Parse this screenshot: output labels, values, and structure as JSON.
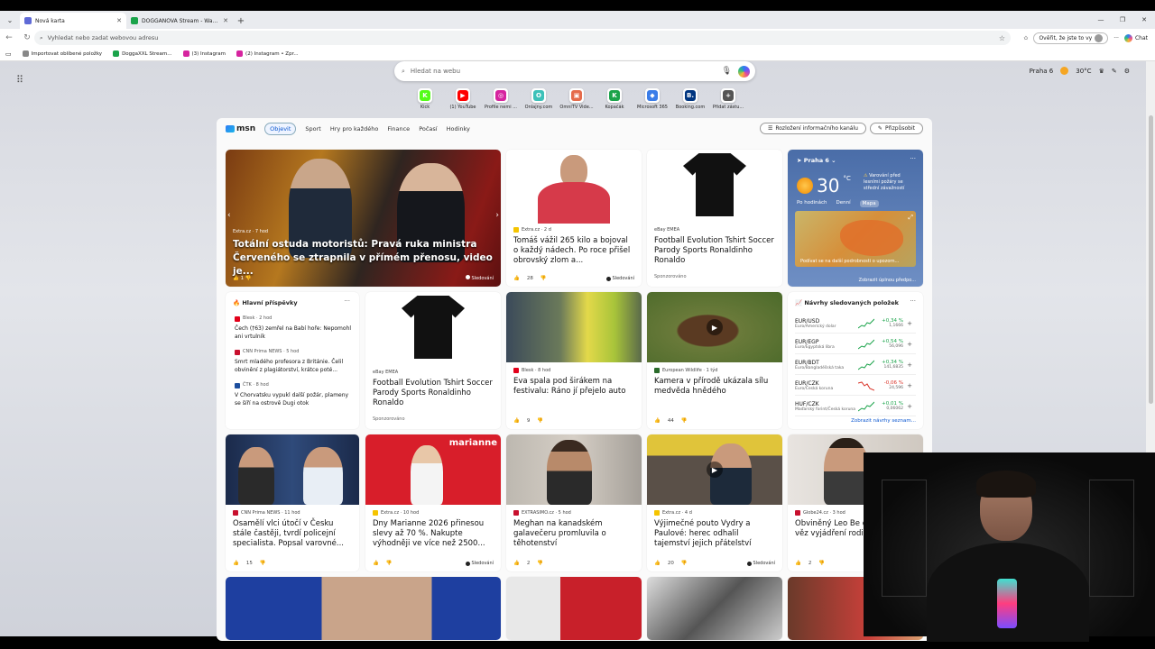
{
  "tabs": [
    {
      "label": "Nová karta",
      "color": "#5f6ad6",
      "active": true
    },
    {
      "label": "DOGGANOVA Stream - Watch Live",
      "color": "#1aa34a",
      "active": false
    }
  ],
  "address": {
    "placeholder": "Vyhledat nebo zadat webovou adresu"
  },
  "nav_right": {
    "verify": "Ověřit, že jste to vy",
    "chat": "Chat"
  },
  "bookmarks": [
    {
      "label": "Importovat oblíbené položky",
      "color": "#666"
    },
    {
      "label": "DoggaXXL Stream...",
      "color": "#1aa34a"
    },
    {
      "label": "(3) Instagram",
      "color": "#d6249f"
    },
    {
      "label": "(2) Instagram • Zpr...",
      "color": "#d6249f"
    }
  ],
  "search": {
    "placeholder": "Hledat na webu"
  },
  "weather_top": {
    "location": "Praha 6",
    "temp": "30",
    "unit": "°C"
  },
  "quick_links": [
    {
      "label": "Kick",
      "letter": "K",
      "color": "#53fc18"
    },
    {
      "label": "(1) YouTube",
      "letter": "▶",
      "color": "#ff0000"
    },
    {
      "label": "Profile nemi ...",
      "letter": "◎",
      "color": "#d6249f"
    },
    {
      "label": "Onlajny.com",
      "letter": "O",
      "color": "#3dc1b9"
    },
    {
      "label": "OmniTV Vide...",
      "letter": "▣",
      "color": "#e56b4b"
    },
    {
      "label": "Kopačák",
      "letter": "K",
      "color": "#1aa34a"
    },
    {
      "label": "Microsoft 365",
      "letter": "◆",
      "color": "#3b7de8"
    },
    {
      "label": "Booking.com",
      "letter": "B.",
      "color": "#003580"
    },
    {
      "label": "Přidat zástu...",
      "letter": "+",
      "color": "#555"
    }
  ],
  "msn": {
    "logo": "msn",
    "tabs": [
      "Objevit",
      "Sport",
      "Hry pro každého",
      "Finance",
      "Počasí",
      "Hodinky"
    ],
    "feed_layout_btn": "Rozložení informačního kanálu",
    "customize_btn": "Přizpůsobit"
  },
  "hero": {
    "source": "Extra.cz · 7 hod",
    "title": "Totální ostuda motoristů: Pravá ruka ministra Červeného se ztrapnila v přímém přenosu, video je...",
    "likes": "1",
    "follow": "Sledování"
  },
  "cards": [
    {
      "source": "Extra.cz · 2 d",
      "src_color": "#f5c400",
      "title": "Tomáš vážil 265 kilo a bojoval o každý nádech. Po roce přišel obrovský zlom a...",
      "likes": "28",
      "follow": "Sledování"
    },
    {
      "source": "eBay EMEA",
      "title": "Football Evolution Tshirt Soccer Parody Sports Ronaldinho Ronaldo",
      "sponsored": "Sponzorováno"
    },
    {
      "source": "eBay EMEA",
      "title": "Football Evolution Tshirt Soccer Parody Sports Ronaldinho Ronaldo",
      "sponsored": "Sponzorováno"
    },
    {
      "source": "Blesk · 8 hod",
      "src_color": "#e2001a",
      "title": "Eva spala pod širákem na festivalu: Ráno jí přejelo auto",
      "likes": "9"
    },
    {
      "source": "European Wildlife · 1 týd",
      "src_color": "#2a6b2a",
      "title": "Kamera v přírodě ukázala sílu medvěda hnědého",
      "likes": "44"
    },
    {
      "source": "CNN Prima NEWS · 11 hod",
      "src_color": "#c8102e",
      "title": "Osamělí vlci útočí v Česku stále častěji, tvrdí policejní specialista. Popsal varovné...",
      "likes": "15"
    },
    {
      "source": "Extra.cz · 10 hod",
      "src_color": "#f5c400",
      "title": "Dny Marianne 2026 přinesou slevy až 70 %. Nakupte výhodněji ve více než 2500...",
      "follow": "Sledování"
    },
    {
      "source": "EXTRASIMO.cz · 5 hod",
      "src_color": "#c8102e",
      "title": "Meghan na kanadském galavečeru promluvila o těhotenství",
      "likes": "2"
    },
    {
      "source": "Extra.cz · 4 d",
      "src_color": "#f5c400",
      "title": "Výjimečné pouto Vydry a Paulové: herec odhalil tajemství jejich přátelství",
      "likes": "20",
      "follow": "Sledování"
    },
    {
      "source": "Globe24.cz · 3 hod",
      "src_color": "#c8102e",
      "title": "Obviněný Leo Be dostat 12 let věz vyjádření rodiny",
      "likes": "2"
    }
  ],
  "weather_card": {
    "location": "Praha 6",
    "temp": "30",
    "unit": "°C",
    "alert": "Varování před lesními požáry se střední závažností",
    "tabs": [
      "Po hodinách",
      "Denní",
      "Mapa"
    ],
    "footer": "Podívat se na další podrobnosti o upozorn...",
    "link": "Zobrazit úplnou předpo..."
  },
  "main_posts": {
    "heading": "Hlavní příspěvky",
    "items": [
      {
        "source": "Blesk · 2 hod",
        "color": "#e2001a",
        "text": "Čech (†63) zemřel na Babí hoře: Nepomohl ani vrtulník"
      },
      {
        "source": "CNN Prima NEWS · 5 hod",
        "color": "#c8102e",
        "text": "Smrt mladého profesora z Británie. Čelil obvinění z plagiátorství, krátce poté..."
      },
      {
        "source": "ČTK · 8 hod",
        "color": "#1d4e9e",
        "text": "V Chorvatsku vypukl další požár, plameny se šíří na ostrově Dugi otok"
      }
    ]
  },
  "watchlist": {
    "heading": "Návrhy sledovaných položek",
    "link": "Zobrazit návrhy seznam...",
    "rows": [
      {
        "pair": "EUR/USD",
        "desc": "Euro/Americký dolar",
        "change": "+0,34 %",
        "value": "1,1666",
        "up": true
      },
      {
        "pair": "EUR/EGP",
        "desc": "Euro/Egyptská libra",
        "change": "+0,54 %",
        "value": "56,096",
        "up": true
      },
      {
        "pair": "EUR/BDT",
        "desc": "Euro/Bangladéšská taka",
        "change": "+0,34 %",
        "value": "141,6835",
        "up": true
      },
      {
        "pair": "EUR/CZK",
        "desc": "Euro/Česká koruna",
        "change": "-0,06 %",
        "value": "24,596",
        "up": false
      },
      {
        "pair": "HUF/CZK",
        "desc": "Maďarský forint/Česká koruna",
        "change": "+0,01 %",
        "value": "0,06062",
        "up": true
      }
    ]
  }
}
